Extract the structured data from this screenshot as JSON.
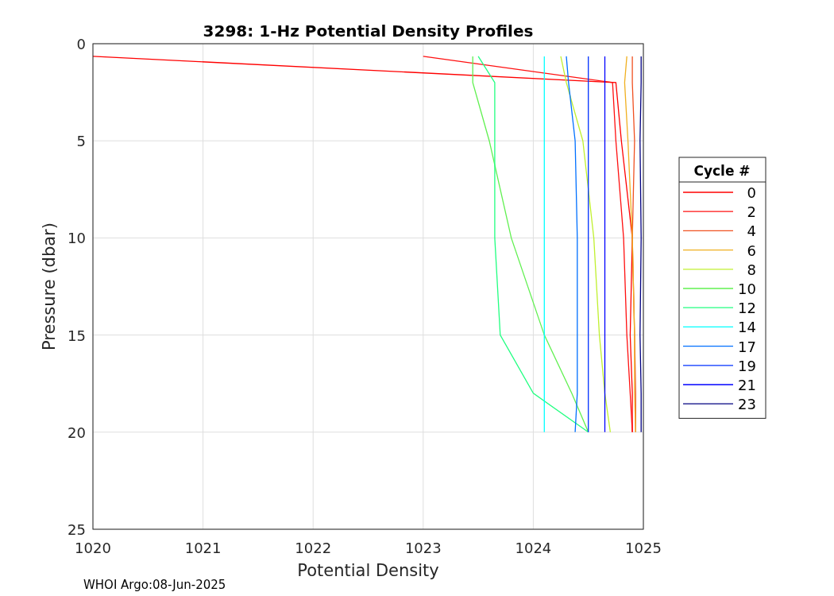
{
  "figure": {
    "title": "3298: 1-Hz Potential Density Profiles",
    "footer": "WHOI Argo:08-Jun-2025",
    "chart_data": {
      "type": "line",
      "orientation": "horizontal",
      "grid": true,
      "legend": {
        "title": "Cycle #"
      },
      "xlabel": "Potential Density",
      "ylabel": "Pressure (dbar)",
      "xlim": [
        1020,
        1025
      ],
      "ylim": [
        25,
        0
      ],
      "xticks": [
        1020,
        1021,
        1022,
        1023,
        1024,
        1025
      ],
      "yticks": [
        0,
        5,
        10,
        15,
        20,
        25
      ],
      "x": [
        0.65,
        2,
        5,
        10,
        15,
        18,
        20
      ],
      "series": [
        {
          "name": "0",
          "color": "#ff0000",
          "values": [
            1020,
            1024.75,
            1024.8,
            1024.9,
            1024.88,
            1024.9,
            1024.9
          ]
        },
        {
          "name": "2",
          "color": "#ff1010",
          "values": [
            1023,
            1024.72,
            1024.75,
            1024.82,
            1024.85,
            1024.88,
            1024.9
          ]
        },
        {
          "name": "4",
          "color": "#f05020",
          "values": [
            1024.9,
            1024.9,
            1024.92,
            1024.9,
            1024.92,
            1024.93,
            1024.93
          ]
        },
        {
          "name": "6",
          "color": "#f0b020",
          "values": [
            1024.85,
            1024.83,
            1024.86,
            1024.9,
            1024.92,
            1024.92,
            1024.93
          ]
        },
        {
          "name": "8",
          "color": "#c0f030",
          "values": [
            1024.25,
            1024.3,
            1024.45,
            1024.55,
            1024.6,
            1024.65,
            1024.7
          ]
        },
        {
          "name": "10",
          "color": "#60f050",
          "values": [
            1023.45,
            1023.45,
            1023.6,
            1023.8,
            1024.1,
            1024.35,
            1024.5
          ]
        },
        {
          "name": "12",
          "color": "#20ff80",
          "values": [
            1023.5,
            1023.65,
            1023.65,
            1023.65,
            1023.7,
            1024,
            1024.5
          ]
        },
        {
          "name": "14",
          "color": "#00ffff",
          "values": [
            1024.1,
            1024.1,
            1024.1,
            1024.1,
            1024.1,
            1024.1,
            1024.1
          ]
        },
        {
          "name": "17",
          "color": "#0070ff",
          "values": [
            1024.3,
            1024.32,
            1024.38,
            1024.4,
            1024.4,
            1024.4,
            1024.38
          ]
        },
        {
          "name": "19",
          "color": "#0030ff",
          "values": [
            1024.5,
            1024.5,
            1024.5,
            1024.5,
            1024.5,
            1024.5,
            1024.5
          ]
        },
        {
          "name": "21",
          "color": "#0000ff",
          "values": [
            1024.65,
            1024.65,
            1024.65,
            1024.65,
            1024.65,
            1024.65,
            1024.65
          ]
        },
        {
          "name": "23",
          "color": "#000080",
          "values": [
            1024.98,
            1024.98,
            1024.97,
            1024.98,
            1024.97,
            1024.98,
            1024.98
          ]
        }
      ]
    }
  }
}
